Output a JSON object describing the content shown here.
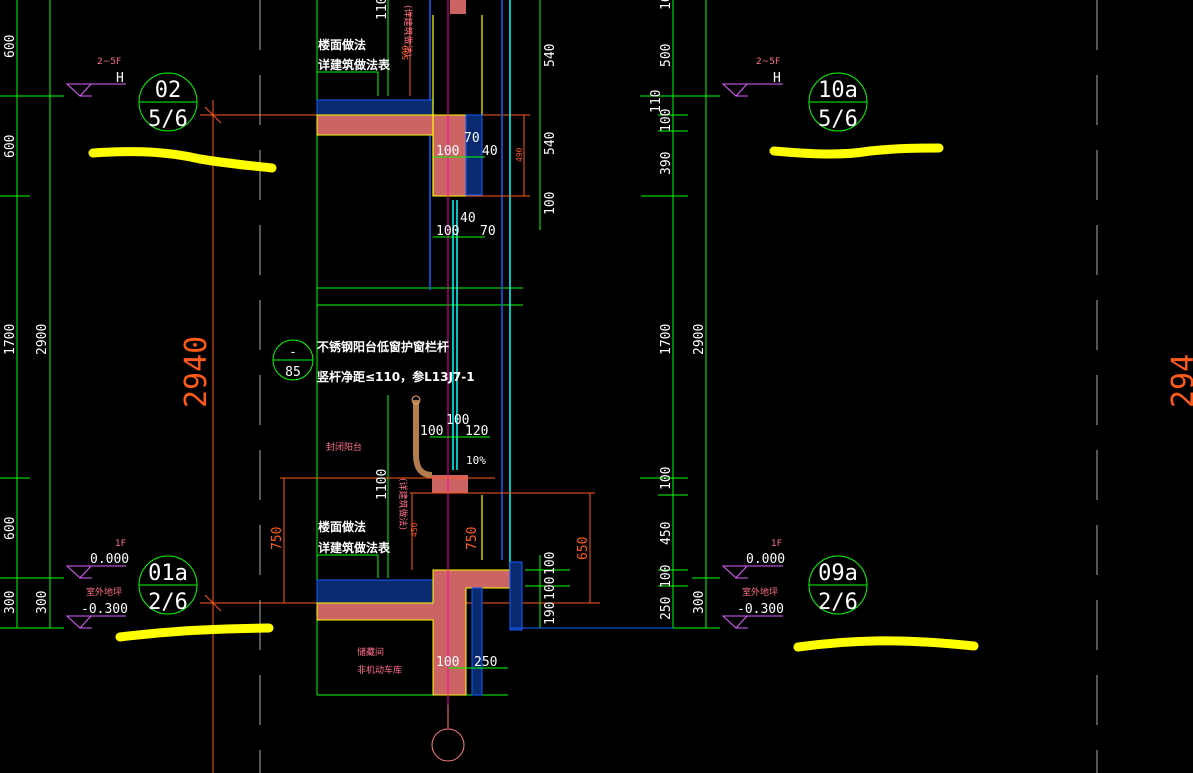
{
  "colors": {
    "background": "#000000",
    "dimension": "#00ff00",
    "concrete": "#cd6464",
    "insulation": "#1060ff",
    "highlight": "#ffff00",
    "elevation_mark": "#e060ff",
    "annotation": "#ff6f8a",
    "axis_dim": "#ff5a1a"
  },
  "left_dims": {
    "a": "600",
    "b": "600",
    "c": "1700",
    "d": "600",
    "e": "300",
    "total": "2900",
    "total2": "300"
  },
  "right_dims": {
    "a": "10",
    "b": "500",
    "c": "110",
    "d": "100",
    "e": "390",
    "f": "1700",
    "g": "100",
    "h": "450",
    "i": "100",
    "j": "250",
    "total": "2900",
    "total2": "300"
  },
  "overall_dim": "2940",
  "overall_dim_right": "294",
  "elev_left": {
    "floors": "2~5F",
    "h": "H",
    "f1": "1F",
    "zero": "0.000",
    "outdoor_label": "室外地坪",
    "outdoor": "-0.300"
  },
  "elev_right": {
    "floors": "2~5F",
    "h": "H",
    "f1": "1F",
    "zero": "0.000",
    "outdoor_label": "室外地坪",
    "outdoor": "-0.300"
  },
  "detail_tags": [
    {
      "top": "02",
      "bottom": "5/6"
    },
    {
      "top": "01a",
      "bottom": "2/6"
    },
    {
      "top": "10a",
      "bottom": "5/6"
    },
    {
      "top": "09a",
      "bottom": "2/6"
    }
  ],
  "railing_tag": {
    "top": "-",
    "bottom": "85"
  },
  "section": {
    "floor_finish": "楼面做法",
    "see_table": "详建筑做法表",
    "floor_finish2": "楼面做法",
    "see_table2": "详建筑做法表",
    "railing_note1": "不锈钢阳台低窗护窗栏杆",
    "railing_note2": "竖杆净距≤110，参L13J7-1",
    "closed_balcony": "封闭阳台",
    "storage1": "储藏间",
    "storage2": "非机动车库",
    "vertical_note1": "(详建筑做法)",
    "vertical_note2": "(详建筑做法)",
    "d110": "110",
    "d540a": "540",
    "d540b": "540",
    "d100r": "100",
    "d100a": "100",
    "d70a": "70",
    "d40a": "40",
    "d40b": "40",
    "d100b": "100",
    "d70b": "70",
    "d500": "500",
    "d490": "490",
    "d100c": "100",
    "d100d": "100",
    "d120": "120",
    "slope": "10%",
    "d1100": "1100",
    "d750a": "750",
    "d750b": "750",
    "d450": "450",
    "d650": "650",
    "d100e": "100",
    "d100f": "100",
    "d190": "190",
    "d100g": "100",
    "d250": "250"
  }
}
